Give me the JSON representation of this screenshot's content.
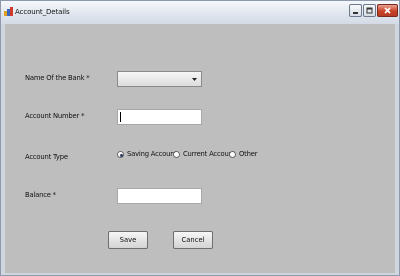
{
  "window": {
    "title": "Account_Details",
    "controls": {
      "minimize": "minimize-icon",
      "maximize": "maximize-icon",
      "close": "close-icon"
    }
  },
  "form": {
    "bank_label": "Name Of the Bank *",
    "bank_selected": "",
    "account_number_label": "Account Number *",
    "account_number_value": "",
    "account_type_label": "Account Type",
    "account_types": [
      {
        "label": "Saving Account",
        "selected": true
      },
      {
        "label": "Current Account",
        "selected": false
      },
      {
        "label": "Other",
        "selected": false
      }
    ],
    "balance_label": "Balance *",
    "balance_value": ""
  },
  "buttons": {
    "save": "Save",
    "cancel": "Cancel"
  },
  "colors": {
    "client_bg": "#bebebe",
    "window_frame": "#cfd6df",
    "close_button": "#c8432a"
  }
}
